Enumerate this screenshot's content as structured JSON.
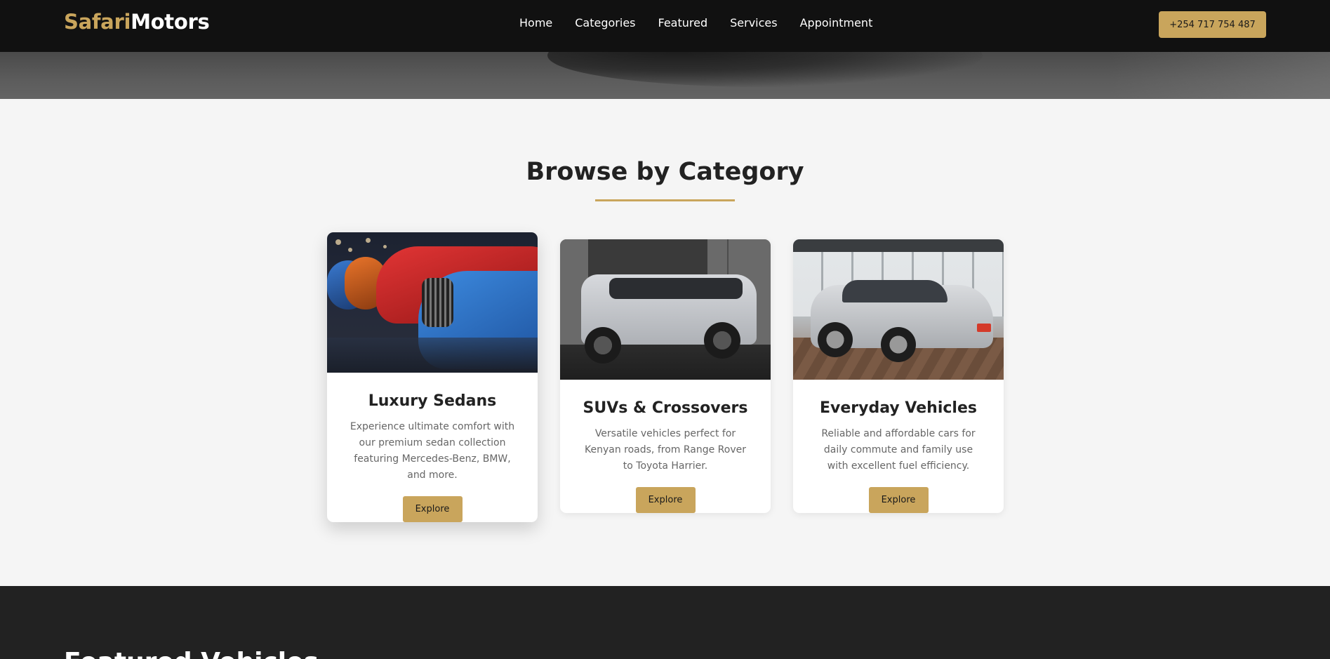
{
  "nav": {
    "logo_part1": "Safari",
    "logo_part2": "Motors",
    "links": [
      "Home",
      "Categories",
      "Featured",
      "Services",
      "Appointment"
    ],
    "phone": "+254 717 754 487"
  },
  "categories": {
    "title": "Browse by Category",
    "cards": [
      {
        "title": "Luxury Sedans",
        "description": "Experience ultimate comfort with our premium sedan collection featuring Mercedes-Benz, BMW, and more.",
        "button": "Explore"
      },
      {
        "title": "SUVs & Crossovers",
        "description": "Versatile vehicles perfect for Kenyan roads, from Range Rover to Toyota Harrier.",
        "button": "Explore"
      },
      {
        "title": "Everyday Vehicles",
        "description": "Reliable and affordable cars for daily commute and family use with excellent fuel efficiency.",
        "button": "Explore"
      }
    ]
  },
  "featured": {
    "title": "Featured Vehicles"
  },
  "colors": {
    "accent": "#c9a55c",
    "navbar": "#111111",
    "page": "#f5f5f5",
    "dark_section": "#222222"
  }
}
